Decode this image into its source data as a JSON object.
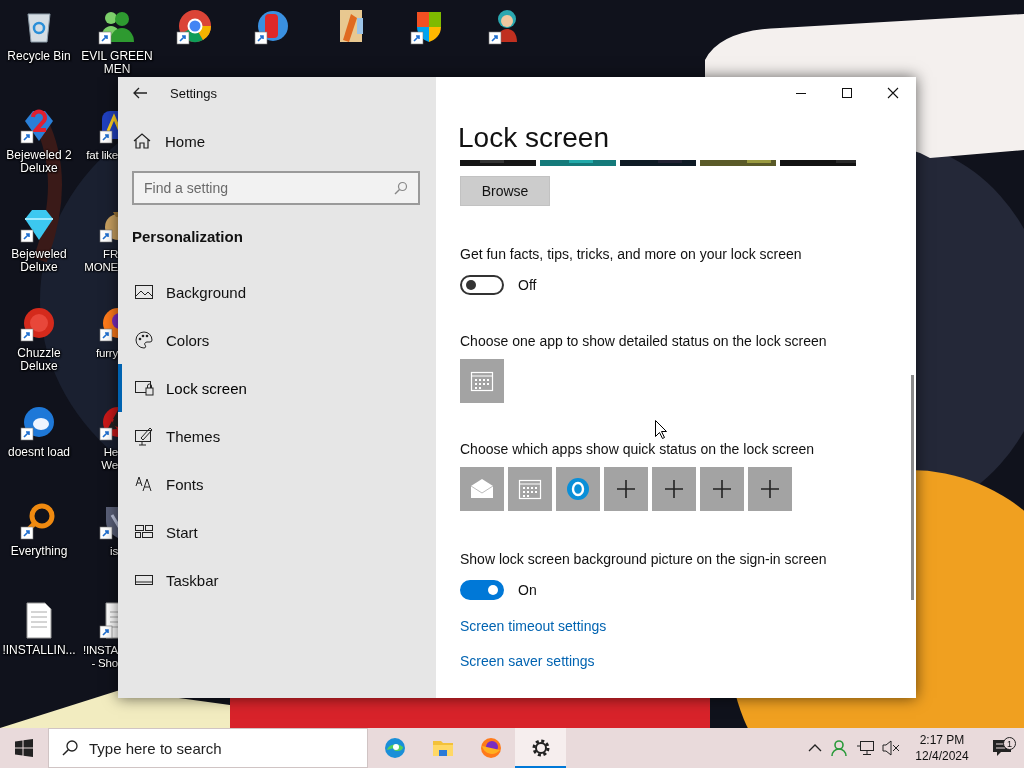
{
  "desktop": {
    "columns": [
      [
        {
          "kind": "recycle-bin",
          "label": [
            "Recycle Bin"
          ],
          "shortcut": false
        },
        {
          "kind": "gem-two",
          "label": [
            "Bejeweled 2",
            "Deluxe"
          ],
          "shortcut": true
        },
        {
          "kind": "gem",
          "label": [
            "Bejeweled",
            "Deluxe"
          ],
          "shortcut": true
        },
        {
          "kind": "fuzzball",
          "label": [
            "Chuzzle",
            "Deluxe"
          ],
          "shortcut": true
        },
        {
          "kind": "bird",
          "label": [
            "doesnt load"
          ],
          "shortcut": true
        },
        {
          "kind": "magnifier",
          "label": [
            "Everything"
          ],
          "shortcut": true
        },
        {
          "kind": "document",
          "label": [
            "!INSTALLIN..."
          ],
          "shortcut": false
        }
      ],
      [
        {
          "kind": "people",
          "label": [
            "EVIL GREEN",
            "MEN"
          ],
          "shortcut": true
        },
        {
          "kind": "blue-logo",
          "label": [
            "fat like"
          ],
          "shortcut": true
        },
        {
          "kind": "bag",
          "label": [
            "FR",
            "MONE"
          ],
          "shortcut": true
        },
        {
          "kind": "fox",
          "label": [
            "furry"
          ],
          "shortcut": true
        },
        {
          "kind": "hazard",
          "label": [
            "He",
            "We"
          ],
          "shortcut": true
        },
        {
          "kind": "dark-shield",
          "label": [
            "is"
          ],
          "shortcut": true
        },
        {
          "kind": "document",
          "label": [
            "!INSTA",
            "- Sho"
          ],
          "shortcut": true
        }
      ],
      [
        {
          "kind": "browser",
          "shortcut": true
        }
      ],
      [
        {
          "kind": "peggle",
          "shortcut": true
        }
      ],
      [
        {
          "kind": "book",
          "shortcut": false
        }
      ],
      [
        {
          "kind": "shield",
          "shortcut": true
        }
      ],
      [
        {
          "kind": "character",
          "shortcut": true
        }
      ]
    ]
  },
  "window": {
    "title": "Settings",
    "nav": {
      "home": "Home",
      "search": {
        "placeholder": "Find a setting"
      },
      "section": "Personalization",
      "items": [
        {
          "kind": "background",
          "label": "Background",
          "selected": false
        },
        {
          "kind": "colors",
          "label": "Colors",
          "selected": false
        },
        {
          "kind": "lock",
          "label": "Lock screen",
          "selected": true
        },
        {
          "kind": "themes",
          "label": "Themes",
          "selected": false
        },
        {
          "kind": "fonts",
          "label": "Fonts",
          "selected": false
        },
        {
          "kind": "start",
          "label": "Start",
          "selected": false
        },
        {
          "kind": "taskbar",
          "label": "Taskbar",
          "selected": false
        }
      ]
    },
    "content": {
      "heading": "Lock screen",
      "browse_button": "Browse",
      "sections": [
        {
          "kind": "toggle",
          "label": "Get fun facts, tips, tricks, and more on your lock screen",
          "on": false,
          "state_label": "Off"
        },
        {
          "kind": "apps",
          "label": "Choose one app to show detailed status on the lock screen",
          "apps": [
            {
              "kind": "calendar"
            }
          ]
        },
        {
          "kind": "apps",
          "label": "Choose which apps show quick status on the lock screen",
          "apps": [
            {
              "kind": "mail"
            },
            {
              "kind": "calendar"
            },
            {
              "kind": "skype"
            },
            {
              "kind": "add"
            },
            {
              "kind": "add"
            },
            {
              "kind": "add"
            },
            {
              "kind": "add"
            }
          ]
        },
        {
          "kind": "toggle",
          "label": "Show lock screen background picture on the sign-in screen",
          "on": true,
          "state_label": "On"
        },
        {
          "kind": "link",
          "label": "Screen timeout settings"
        },
        {
          "kind": "link",
          "label": "Screen saver settings"
        }
      ]
    }
  },
  "taskbar": {
    "search": {
      "placeholder": "Type here to search"
    },
    "apps": [
      {
        "kind": "edge",
        "selected": false
      },
      {
        "kind": "folder",
        "selected": false
      },
      {
        "kind": "firefox",
        "selected": false
      },
      {
        "kind": "settings",
        "selected": true
      }
    ],
    "clock": {
      "time": "2:17 PM",
      "date": "12/4/2024"
    },
    "notifications": {
      "badge": "1"
    }
  }
}
